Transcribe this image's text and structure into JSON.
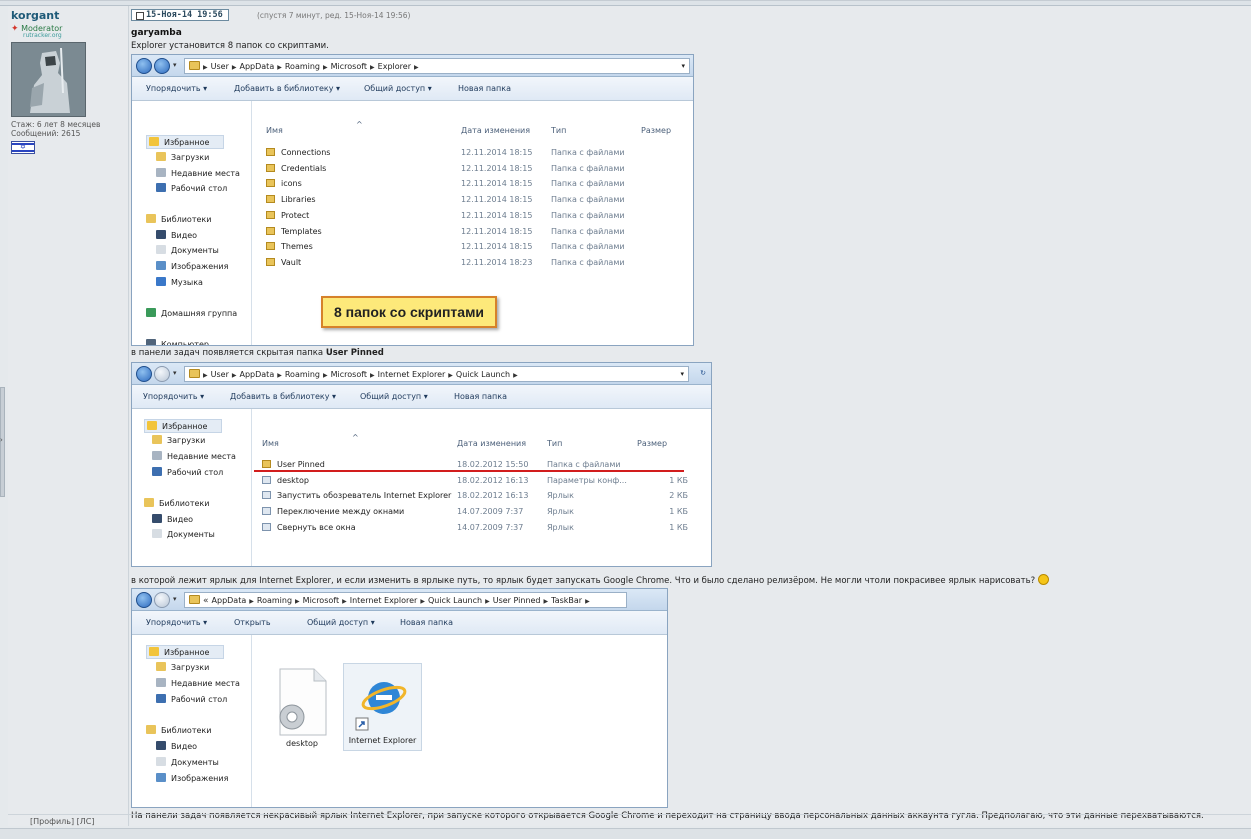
{
  "user": {
    "name": "korgant",
    "rank": "Moderator",
    "site": "rutracker.org",
    "stat_line1": "Стаж: 6 лет 8 месяцев",
    "stat_line2": "Сообщений: 2615",
    "profile_label": "[Профиль]",
    "pm_label": "[ЛС]"
  },
  "post": {
    "date": "15-Ноя-14 19:56",
    "edited": "(спустя 7 минут, ред. 15-Ноя-14 19:56)",
    "quote_user": "garyamba",
    "line1": "Explorer установится 8 папок со скриптами.",
    "line2_prefix": "в панели задач появляется скрытая папка",
    "line2_bold": "User Pinned",
    "line3": "в которой лежит ярлык для Internet Explorer, и если изменить в ярлыке путь, то ярлык будет запускать Google Chrome. Что и было сделано релизёром. Не могли чтоли покрасивее ярлык нарисовать?",
    "line4": "На панели задач появляется некрасивый ярлык Internet Explorer, при запуске которого открывается Google Chrome и переходит на страницу ввода персональных данных аккаунта гугла. Предполагаю, что эти данные перехватываются."
  },
  "explorer1": {
    "crumbs": [
      "User",
      "AppData",
      "Roaming",
      "Microsoft",
      "Explorer"
    ],
    "toolbar": [
      "Упорядочить ▾",
      "Добавить в библиотеку ▾",
      "Общий доступ ▾",
      "Новая папка"
    ],
    "nav": [
      "Избранное",
      "Загрузки",
      "Недавние места",
      "Рабочий стол",
      "Библиотеки",
      "Видео",
      "Документы",
      "Изображения",
      "Музыка",
      "Домашняя группа",
      "Компьютер"
    ],
    "headers": [
      "Имя",
      "Дата изменения",
      "Тип",
      "Размер"
    ],
    "rows": [
      {
        "name": "Connections",
        "date": "12.11.2014 18:15",
        "type": "Папка с файлами"
      },
      {
        "name": "Credentials",
        "date": "12.11.2014 18:15",
        "type": "Папка с файлами"
      },
      {
        "name": "icons",
        "date": "12.11.2014 18:15",
        "type": "Папка с файлами"
      },
      {
        "name": "Libraries",
        "date": "12.11.2014 18:15",
        "type": "Папка с файлами"
      },
      {
        "name": "Protect",
        "date": "12.11.2014 18:15",
        "type": "Папка с файлами"
      },
      {
        "name": "Templates",
        "date": "12.11.2014 18:15",
        "type": "Папка с файлами"
      },
      {
        "name": "Themes",
        "date": "12.11.2014 18:15",
        "type": "Папка с файлами"
      },
      {
        "name": "Vault",
        "date": "12.11.2014 18:23",
        "type": "Папка с файлами"
      }
    ],
    "callout": "8 папок со скриптами"
  },
  "explorer2": {
    "crumbs": [
      "User",
      "AppData",
      "Roaming",
      "Microsoft",
      "Internet Explorer",
      "Quick Launch"
    ],
    "toolbar": [
      "Упорядочить ▾",
      "Добавить в библиотеку ▾",
      "Общий доступ ▾",
      "Новая папка"
    ],
    "nav": [
      "Избранное",
      "Загрузки",
      "Недавние места",
      "Рабочий стол",
      "Библиотеки",
      "Видео",
      "Документы"
    ],
    "headers": [
      "Имя",
      "Дата изменения",
      "Тип",
      "Размер"
    ],
    "rows": [
      {
        "name": "User Pinned",
        "date": "18.02.2012 15:50",
        "type": "Папка с файлами",
        "size": ""
      },
      {
        "name": "desktop",
        "date": "18.02.2012 16:13",
        "type": "Параметры конф...",
        "size": "1 КБ"
      },
      {
        "name": "Запустить обозреватель Internet Explorer",
        "date": "18.02.2012 16:13",
        "type": "Ярлык",
        "size": "2 КБ"
      },
      {
        "name": "Переключение между окнами",
        "date": "14.07.2009 7:37",
        "type": "Ярлык",
        "size": "1 КБ"
      },
      {
        "name": "Свернуть все окна",
        "date": "14.07.2009 7:37",
        "type": "Ярлык",
        "size": "1 КБ"
      }
    ]
  },
  "explorer3": {
    "crumbs": [
      "AppData",
      "Roaming",
      "Microsoft",
      "Internet Explorer",
      "Quick Launch",
      "User Pinned",
      "TaskBar"
    ],
    "toolbar": [
      "Упорядочить ▾",
      "Открыть",
      "Общий доступ ▾",
      "Новая папка"
    ],
    "nav": [
      "Избранное",
      "Загрузки",
      "Недавние места",
      "Рабочий стол",
      "Библиотеки",
      "Видео",
      "Документы",
      "Изображения"
    ],
    "icons": [
      "desktop",
      "Internet Explorer"
    ]
  }
}
